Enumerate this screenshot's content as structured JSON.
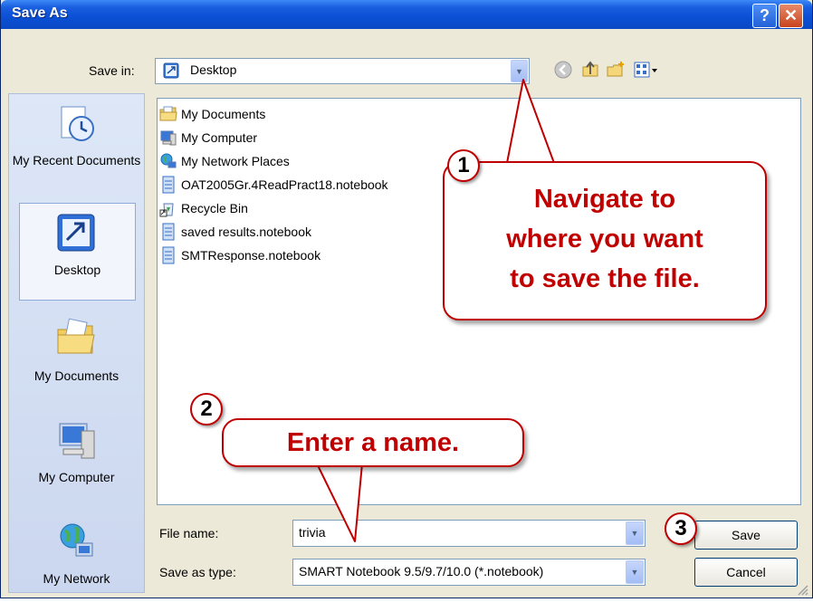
{
  "window": {
    "title": "Save As",
    "help_label": "?",
    "close_label": "✕"
  },
  "save_in": {
    "label": "Save in:",
    "value": "Desktop"
  },
  "toolbar_icons": [
    "back-icon",
    "up-folder-icon",
    "new-folder-icon",
    "view-menu-icon"
  ],
  "places": [
    {
      "label": "My Recent Documents",
      "icon": "recent-documents-icon"
    },
    {
      "label": "Desktop",
      "icon": "desktop-icon"
    },
    {
      "label": "My Documents",
      "icon": "my-documents-icon"
    },
    {
      "label": "My Computer",
      "icon": "my-computer-icon"
    },
    {
      "label": "My Network",
      "icon": "my-network-icon"
    }
  ],
  "files": [
    {
      "name": "My Documents",
      "icon": "folder-icon"
    },
    {
      "name": "My Computer",
      "icon": "computer-icon"
    },
    {
      "name": "My Network Places",
      "icon": "network-icon"
    },
    {
      "name": "OAT2005Gr.4ReadPract18.notebook",
      "icon": "notebook-file-icon"
    },
    {
      "name": "Recycle Bin",
      "icon": "recycle-bin-icon"
    },
    {
      "name": "saved results.notebook",
      "icon": "notebook-file-icon"
    },
    {
      "name": "SMTResponse.notebook",
      "icon": "notebook-file-icon"
    }
  ],
  "file_name": {
    "label": "File name:",
    "value": "trivia"
  },
  "save_as_type": {
    "label": "Save as type:",
    "value": "SMART Notebook 9.5/9.7/10.0 (*.notebook)"
  },
  "buttons": {
    "save": "Save",
    "cancel": "Cancel"
  },
  "callouts": [
    {
      "number": "1",
      "text_lines": [
        "Navigate to",
        "where you want",
        "to save the file."
      ]
    },
    {
      "number": "2",
      "text_lines": [
        "Enter a name."
      ]
    },
    {
      "number": "3",
      "text_lines": []
    }
  ],
  "colors": {
    "title_blue": "#0a4fd4",
    "callout_red": "#c00000",
    "dialog_bg": "#ece9d8"
  }
}
